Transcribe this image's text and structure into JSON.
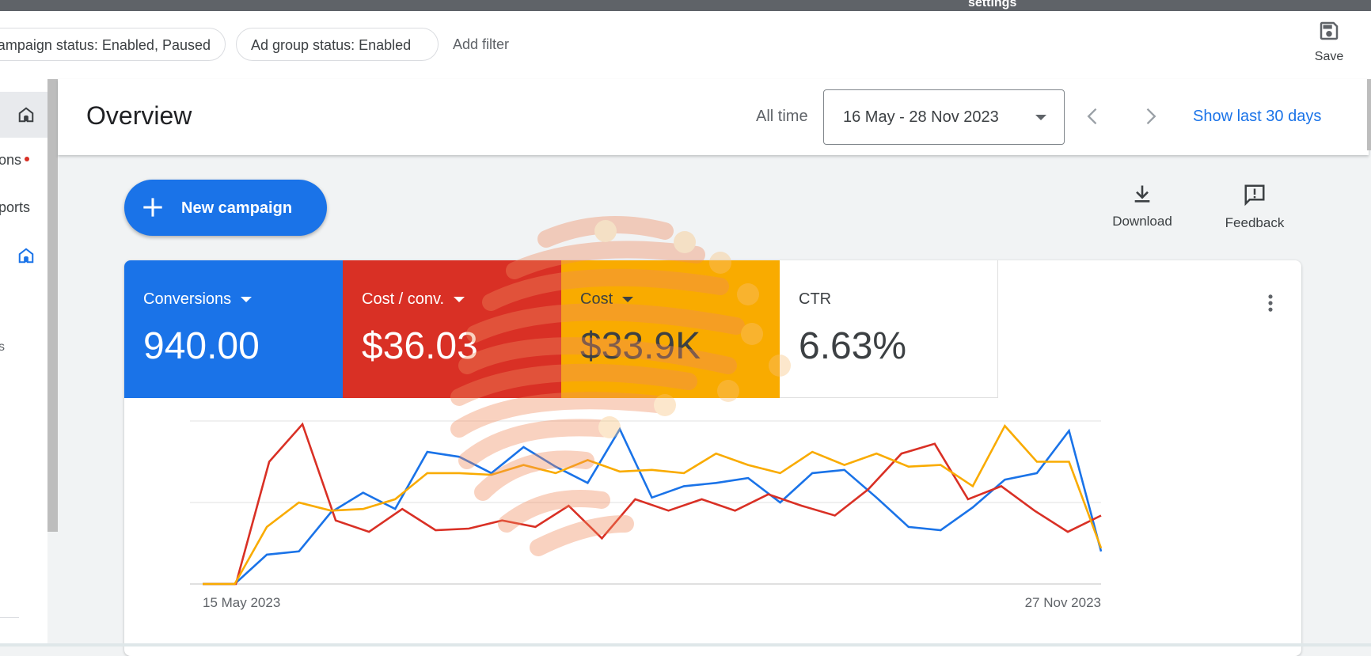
{
  "window": {
    "title_partial": "settings"
  },
  "filters": {
    "chips": [
      {
        "label": "Campaign status: Enabled, Paused"
      },
      {
        "label": "Ad group status: Enabled"
      }
    ],
    "add_filter": "Add filter",
    "save_label": "Save"
  },
  "nav": {
    "items": [
      {
        "label": "",
        "icon": "home-icon",
        "selected": true
      },
      {
        "label": "Recommendations",
        "visible_text": "ons",
        "icon": "lightbulb-icon",
        "badge": "red-dot"
      },
      {
        "label": "Reports",
        "visible_text": "ports",
        "icon": "chart-icon"
      },
      {
        "label": "",
        "icon": "home-icon-blue"
      }
    ],
    "partial_text": "s"
  },
  "overview": {
    "title": "Overview",
    "all_time": "All time",
    "date_range": "16 May - 28 Nov 2023",
    "show_last_30": "Show last 30 days"
  },
  "actions": {
    "new_campaign": "New campaign",
    "download": "Download",
    "feedback": "Feedback"
  },
  "metrics": [
    {
      "name": "Conversions",
      "value": "940.00",
      "color": "#1a73e8"
    },
    {
      "name": "Cost / conv.",
      "value": "$36.03",
      "color": "#d93025"
    },
    {
      "name": "Cost",
      "value": "$33.9K",
      "color": "#f9ab00"
    },
    {
      "name": "CTR",
      "value": "6.63%",
      "color": "#ffffff"
    }
  ],
  "chart_data": {
    "type": "line",
    "x_start_label": "15 May 2023",
    "x_end_label": "27 Nov 2023",
    "grid": "horizontal",
    "ylim": [
      0,
      100
    ],
    "series": [
      {
        "name": "Conversions",
        "color": "#1a73e8",
        "values": [
          0,
          0,
          18,
          20,
          44,
          56,
          46,
          81,
          78,
          68,
          84,
          72,
          62,
          95,
          53,
          60,
          62,
          65,
          50,
          68,
          70,
          53,
          35,
          33,
          47,
          64,
          68,
          94,
          20
        ]
      },
      {
        "name": "Cost / conv.",
        "color": "#d93025",
        "values": [
          0,
          0,
          75,
          98,
          39,
          32,
          46,
          33,
          34,
          39,
          35,
          48,
          28,
          52,
          45,
          52,
          45,
          55,
          48,
          42,
          58,
          80,
          86,
          52,
          60,
          45,
          32,
          42
        ]
      },
      {
        "name": "Cost",
        "color": "#f9ab00",
        "values": [
          0,
          0,
          35,
          50,
          45,
          46,
          52,
          68,
          68,
          67,
          73,
          68,
          76,
          69,
          70,
          68,
          80,
          73,
          68,
          81,
          73,
          80,
          72,
          73,
          60,
          97,
          75,
          75,
          22
        ]
      }
    ]
  }
}
